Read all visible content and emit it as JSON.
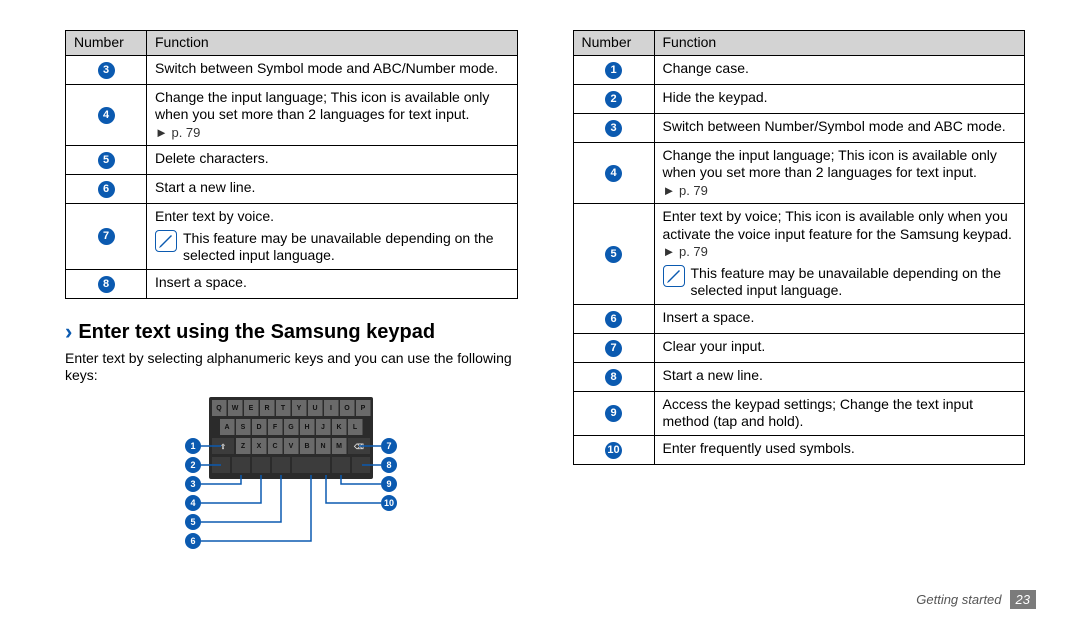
{
  "left_table": {
    "headers": {
      "number": "Number",
      "function": "Function"
    },
    "rows": [
      {
        "num": "3",
        "text": "Switch between Symbol mode and ABC/Number mode."
      },
      {
        "num": "4",
        "text": "Change the input language; This icon is available only when you set more than 2 languages for text input.",
        "ref": "► p. 79"
      },
      {
        "num": "5",
        "text": "Delete characters."
      },
      {
        "num": "6",
        "text": "Start a new line."
      },
      {
        "num": "7",
        "text": "Enter text by voice.",
        "note": "This feature may be unavailable depending on the selected input language."
      },
      {
        "num": "8",
        "text": "Insert a space."
      }
    ]
  },
  "section": {
    "heading": "Enter text using the Samsung keypad",
    "body": "Enter text by selecting alphanumeric keys and you can use the following keys:"
  },
  "right_table": {
    "headers": {
      "number": "Number",
      "function": "Function"
    },
    "rows": [
      {
        "num": "1",
        "text": "Change case."
      },
      {
        "num": "2",
        "text": "Hide the keypad."
      },
      {
        "num": "3",
        "text": "Switch between Number/Symbol mode and ABC mode."
      },
      {
        "num": "4",
        "text": "Change the input language; This icon is available only when you set more than 2 languages for text input.",
        "ref": "► p. 79"
      },
      {
        "num": "5",
        "text": "Enter text by voice; This icon is available only when you activate the voice input feature for the Samsung keypad.",
        "ref": "► p. 79",
        "note": "This feature may be unavailable depending on the selected input language."
      },
      {
        "num": "6",
        "text": "Insert a space."
      },
      {
        "num": "7",
        "text": "Clear your input."
      },
      {
        "num": "8",
        "text": "Start a new line."
      },
      {
        "num": "9",
        "text": "Access the keypad settings; Change the text input method (tap and hold)."
      },
      {
        "num": "10",
        "text": "Enter frequently used symbols."
      }
    ]
  },
  "keypad": {
    "row1": [
      "Q",
      "W",
      "E",
      "R",
      "T",
      "Y",
      "U",
      "I",
      "O",
      "P"
    ],
    "row2": [
      "A",
      "S",
      "D",
      "F",
      "G",
      "H",
      "J",
      "K",
      "L"
    ],
    "row3": [
      "Z",
      "X",
      "C",
      "V",
      "B",
      "N",
      "M"
    ],
    "callouts_left": [
      "1",
      "2",
      "3",
      "4",
      "5",
      "6"
    ],
    "callouts_right": [
      "7",
      "8",
      "9",
      "10"
    ]
  },
  "footer": {
    "section": "Getting started",
    "page": "23"
  }
}
